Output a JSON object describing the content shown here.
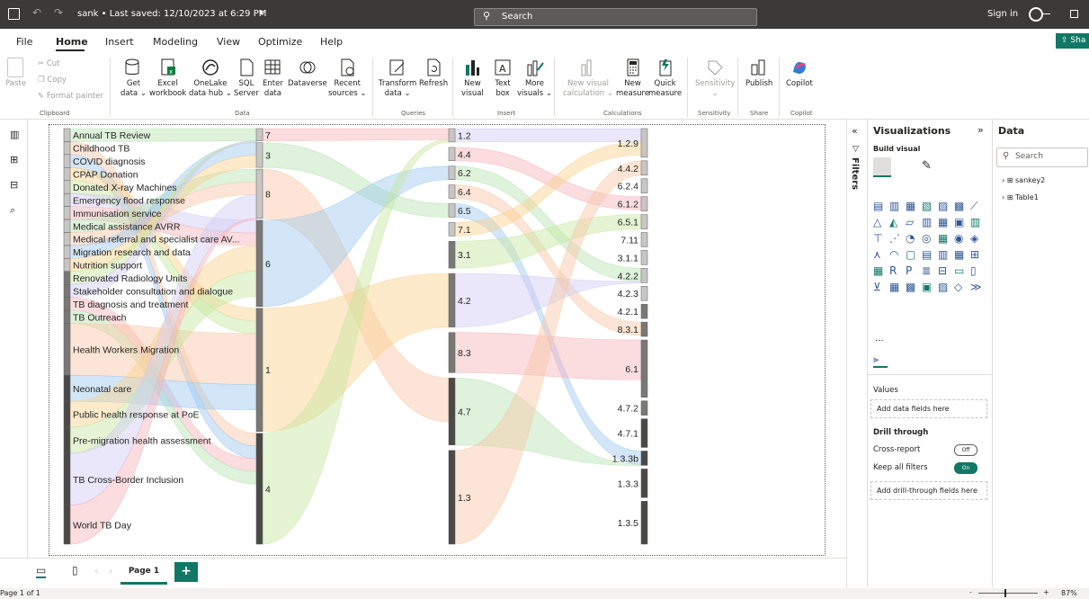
{
  "titlebar": {
    "title": "sank • Last saved: 12/10/2023 at 6:29 PM",
    "search_placeholder": "Search",
    "signin": "Sign in"
  },
  "menu": {
    "items": [
      "File",
      "Home",
      "Insert",
      "Modeling",
      "View",
      "Optimize",
      "Help"
    ],
    "active": "Home",
    "share": "Sha"
  },
  "ribbon": {
    "clipboard": {
      "paste": "Paste",
      "cut": "Cut",
      "copy": "Copy",
      "format_painter": "Format painter",
      "group": "Clipboard"
    },
    "data": {
      "get_data": [
        "Get",
        "data ⌄"
      ],
      "excel": [
        "Excel",
        "workbook"
      ],
      "onelake": [
        "OneLake",
        "data hub ⌄"
      ],
      "sql": [
        "SQL",
        "Server"
      ],
      "enter": [
        "Enter",
        "data"
      ],
      "dataverse": "Dataverse",
      "recent": [
        "Recent",
        "sources ⌄"
      ],
      "group": "Data"
    },
    "queries": {
      "transform": [
        "Transform",
        "data ⌄"
      ],
      "refresh": "Refresh",
      "group": "Queries"
    },
    "insert": {
      "new_visual": [
        "New",
        "visual"
      ],
      "text_box": [
        "Text",
        "box"
      ],
      "more_visuals": [
        "More",
        "visuals ⌄"
      ],
      "group": "Insert"
    },
    "calculations": {
      "new_visual_calc": [
        "New visual",
        "calculation ⌄"
      ],
      "new_measure": [
        "New",
        "measure"
      ],
      "quick_measure": [
        "Quick",
        "measure"
      ],
      "group": "Calculations"
    },
    "sensitivity": {
      "label": "Sensitivity",
      "group": "Sensitivity"
    },
    "share": {
      "publish": "Publish",
      "group": "Share"
    },
    "copilot": {
      "label": "Copilot",
      "group": "Copilot"
    }
  },
  "chart_data": {
    "type": "sankey",
    "sources": [
      {
        "name": "Annual TB Review",
        "weight": 1
      },
      {
        "name": "Childhood TB",
        "weight": 1
      },
      {
        "name": "COVID diagnosis",
        "weight": 1
      },
      {
        "name": "CPAP Donation",
        "weight": 1
      },
      {
        "name": "Donated X-ray Machines",
        "weight": 1
      },
      {
        "name": "Emergency flood response",
        "weight": 1
      },
      {
        "name": "Immunisation service",
        "weight": 1
      },
      {
        "name": "Medical assistance AVRR",
        "weight": 1
      },
      {
        "name": "Medical referral and specialist care AV...",
        "weight": 1
      },
      {
        "name": "Migration research and data",
        "weight": 1
      },
      {
        "name": "Nutrition support",
        "weight": 1
      },
      {
        "name": "Renovated Radiology Units",
        "weight": 1
      },
      {
        "name": "Stakeholder consultation and dialogue",
        "weight": 1
      },
      {
        "name": "TB diagnosis and treatment",
        "weight": 1
      },
      {
        "name": "TB Outreach",
        "weight": 1
      },
      {
        "name": "Health Workers Migration",
        "weight": 4
      },
      {
        "name": "Neonatal care",
        "weight": 2
      },
      {
        "name": "Public health response at PoE",
        "weight": 2
      },
      {
        "name": "Pre-migration health assessment",
        "weight": 2
      },
      {
        "name": "TB Cross-Border Inclusion",
        "weight": 4
      },
      {
        "name": "World TB Day",
        "weight": 3
      }
    ],
    "middle": [
      {
        "name": "7",
        "weight": 1
      },
      {
        "name": "3",
        "weight": 2
      },
      {
        "name": "8",
        "weight": 4
      },
      {
        "name": "6",
        "weight": 7
      },
      {
        "name": "1",
        "weight": 10
      },
      {
        "name": "4",
        "weight": 9
      }
    ],
    "third": [
      {
        "name": "1.2",
        "weight": 1
      },
      {
        "name": "4.4",
        "weight": 1
      },
      {
        "name": "6.2",
        "weight": 1
      },
      {
        "name": "6.4",
        "weight": 1
      },
      {
        "name": "6.5",
        "weight": 1
      },
      {
        "name": "7.1",
        "weight": 1
      },
      {
        "name": "3.1",
        "weight": 2
      },
      {
        "name": "4.2",
        "weight": 4
      },
      {
        "name": "8.3",
        "weight": 3
      },
      {
        "name": "4.7",
        "weight": 5
      },
      {
        "name": "1.3",
        "weight": 7
      }
    ],
    "targets": [
      {
        "name": "1.2.9",
        "weight": 2
      },
      {
        "name": "4.4.2",
        "weight": 1
      },
      {
        "name": "6.2.4",
        "weight": 1
      },
      {
        "name": "6.1.2",
        "weight": 1
      },
      {
        "name": "6.5.1",
        "weight": 1
      },
      {
        "name": "7.11",
        "weight": 1
      },
      {
        "name": "3.1.1",
        "weight": 1
      },
      {
        "name": "4.2.2",
        "weight": 1
      },
      {
        "name": "4.2.3",
        "weight": 1
      },
      {
        "name": "4.2.1",
        "weight": 1
      },
      {
        "name": "8.3.1",
        "weight": 1
      },
      {
        "name": "6.1",
        "weight": 4
      },
      {
        "name": "4.7.2",
        "weight": 1
      },
      {
        "name": "4.7.1",
        "weight": 2
      },
      {
        "name": "1.3.3b",
        "weight": 1
      },
      {
        "name": "1.3.3",
        "weight": 2
      },
      {
        "name": "1.3.5",
        "weight": 3
      }
    ]
  },
  "filters": {
    "label": "Filters"
  },
  "visualizations": {
    "title": "Visualizations",
    "build_visual": "Build visual",
    "values": "Values",
    "add_data_fields": "Add data fields here",
    "drill_through": "Drill through",
    "cross_report": "Cross-report",
    "cross_report_state": "Off",
    "keep_all_filters": "Keep all filters",
    "keep_all_filters_state": "On",
    "add_drill_fields": "Add drill-through fields here",
    "more": "..."
  },
  "data_pane": {
    "title": "Data",
    "search_placeholder": "Search",
    "tables": [
      "sankey2",
      "Table1"
    ]
  },
  "pages": {
    "current": "Page 1",
    "add": "+"
  },
  "status": {
    "page": "Page 1 of 1",
    "zoom": "87%"
  }
}
